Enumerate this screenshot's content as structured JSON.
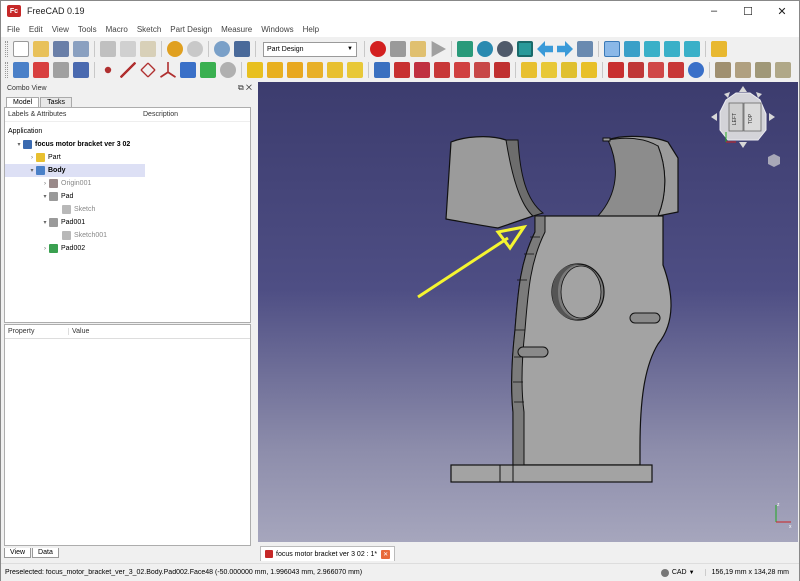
{
  "window": {
    "title": "FreeCAD 0.19",
    "logo_text": "Fc",
    "min": "–",
    "max": "☐",
    "close": "✕"
  },
  "menu": [
    "File",
    "Edit",
    "View",
    "Tools",
    "Macro",
    "Sketch",
    "Part Design",
    "Measure",
    "Windows",
    "Help"
  ],
  "workbench": {
    "selected": "Part Design"
  },
  "combo_view": {
    "title": "Combo View",
    "tabs": [
      "Model",
      "Tasks"
    ],
    "tree_headers": {
      "labels": "Labels & Attributes",
      "description": "Description"
    },
    "tree": [
      {
        "label": "Application",
        "indent": 0,
        "icon": "none",
        "twisty": "",
        "bold": false
      },
      {
        "label": "focus motor bracket ver 3 02",
        "indent": 1,
        "icon": "document-icon",
        "twisty": "▾",
        "bold": true
      },
      {
        "label": "Part",
        "indent": 2,
        "icon": "part-icon",
        "twisty": "›",
        "bold": false
      },
      {
        "label": "Body",
        "indent": 2,
        "icon": "body-icon",
        "twisty": "▾",
        "bold": true
      },
      {
        "label": "Origin001",
        "indent": 3,
        "icon": "origin-icon",
        "twisty": "›",
        "bold": false
      },
      {
        "label": "Pad",
        "indent": 3,
        "icon": "pad-icon",
        "twisty": "▾",
        "bold": false
      },
      {
        "label": "Sketch",
        "indent": 4,
        "icon": "sketch-icon",
        "twisty": "",
        "bold": false
      },
      {
        "label": "Pad001",
        "indent": 3,
        "icon": "pad-icon",
        "twisty": "▾",
        "bold": false
      },
      {
        "label": "Sketch001",
        "indent": 4,
        "icon": "sketch-icon",
        "twisty": "",
        "bold": false
      },
      {
        "label": "Pad002",
        "indent": 3,
        "icon": "pad-active-icon",
        "twisty": "›",
        "bold": false
      }
    ],
    "property_headers": {
      "property": "Property",
      "value": "Value"
    },
    "bottom_tabs": [
      "View",
      "Data"
    ]
  },
  "document_tab": {
    "label": "focus motor bracket ver 3 02 : 1*"
  },
  "navicube": {
    "left": "LEFT",
    "top": "TOP"
  },
  "statusbar": {
    "preselected": "Preselected: focus_motor_bracket_ver_3_02.Body.Pad002.Face48 (-50.000000 mm, 1.996043 mm, 2.966070 mm)",
    "nav_style": "CAD",
    "dimensions": "156,19 mm x 134,28 mm"
  },
  "colors": {
    "accent": "#0078d7",
    "annotation_arrow": "#f5f530",
    "model_gray": "#9b9b9b"
  }
}
